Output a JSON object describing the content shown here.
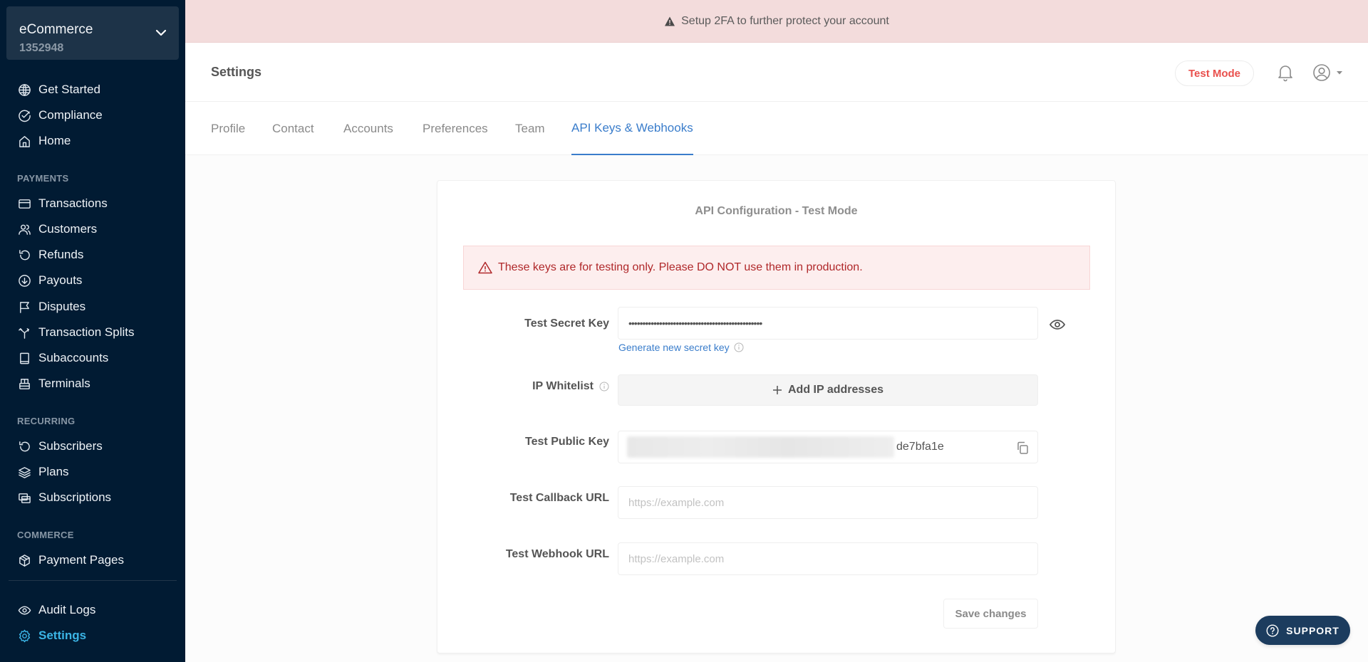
{
  "sidebar": {
    "business": {
      "name": "eCommerce",
      "id": "1352948"
    },
    "top_items": [
      {
        "label": "Get Started",
        "icon": "globe-icon"
      },
      {
        "label": "Compliance",
        "icon": "check-circle-icon"
      },
      {
        "label": "Home",
        "icon": "home-icon"
      }
    ],
    "sections": [
      {
        "title": "PAYMENTS",
        "items": [
          {
            "label": "Transactions",
            "icon": "credit-card-icon"
          },
          {
            "label": "Customers",
            "icon": "users-icon"
          },
          {
            "label": "Refunds",
            "icon": "refresh-icon"
          },
          {
            "label": "Payouts",
            "icon": "download-circle-icon"
          },
          {
            "label": "Disputes",
            "icon": "flag-icon"
          },
          {
            "label": "Transaction Splits",
            "icon": "split-icon"
          },
          {
            "label": "Subaccounts",
            "icon": "book-icon"
          },
          {
            "label": "Terminals",
            "icon": "terminal-icon"
          }
        ]
      },
      {
        "title": "RECURRING",
        "items": [
          {
            "label": "Subscribers",
            "icon": "refresh-icon"
          },
          {
            "label": "Plans",
            "icon": "layers-icon"
          },
          {
            "label": "Subscriptions",
            "icon": "cards-icon"
          }
        ]
      },
      {
        "title": "COMMERCE",
        "items": [
          {
            "label": "Payment Pages",
            "icon": "box-icon"
          }
        ]
      }
    ],
    "bottom_items": [
      {
        "label": "Audit Logs",
        "icon": "eye-icon"
      },
      {
        "label": "Settings",
        "icon": "gear-icon",
        "active": true
      }
    ]
  },
  "banner": {
    "text": "Setup 2FA to further protect your account"
  },
  "header": {
    "title": "Settings",
    "test_mode_label": "Test Mode"
  },
  "tabs": [
    {
      "label": "Profile"
    },
    {
      "label": "Contact"
    },
    {
      "label": "Accounts"
    },
    {
      "label": "Preferences"
    },
    {
      "label": "Team"
    },
    {
      "label": "API Keys & Webhooks",
      "active": true
    }
  ],
  "card": {
    "title": "API Configuration - Test Mode",
    "alert": "These keys are for testing only. Please DO NOT use them in production.",
    "fields": {
      "secret_key": {
        "label": "Test Secret Key",
        "value": "••••••••••••••••••••••••••••••••••••••••••••••••",
        "generate_link": "Generate new secret key"
      },
      "ip_whitelist": {
        "label": "IP Whitelist",
        "button": "Add IP addresses"
      },
      "public_key": {
        "label": "Test Public Key",
        "visible_suffix": "de7bfa1e"
      },
      "callback_url": {
        "label": "Test Callback URL",
        "value": "",
        "placeholder": "https://example.com"
      },
      "webhook_url": {
        "label": "Test Webhook URL",
        "value": "",
        "placeholder": "https://example.com"
      }
    },
    "save_label": "Save changes"
  },
  "support": {
    "label": "SUPPORT"
  },
  "colors": {
    "sidebar_bg": "#011b33",
    "accent_blue": "#3a7dcb",
    "active_nav": "#3bb4e5",
    "test_mode_red": "#e9504d",
    "alert_red": "#b0282a",
    "support_bg": "#1c3c5e"
  }
}
